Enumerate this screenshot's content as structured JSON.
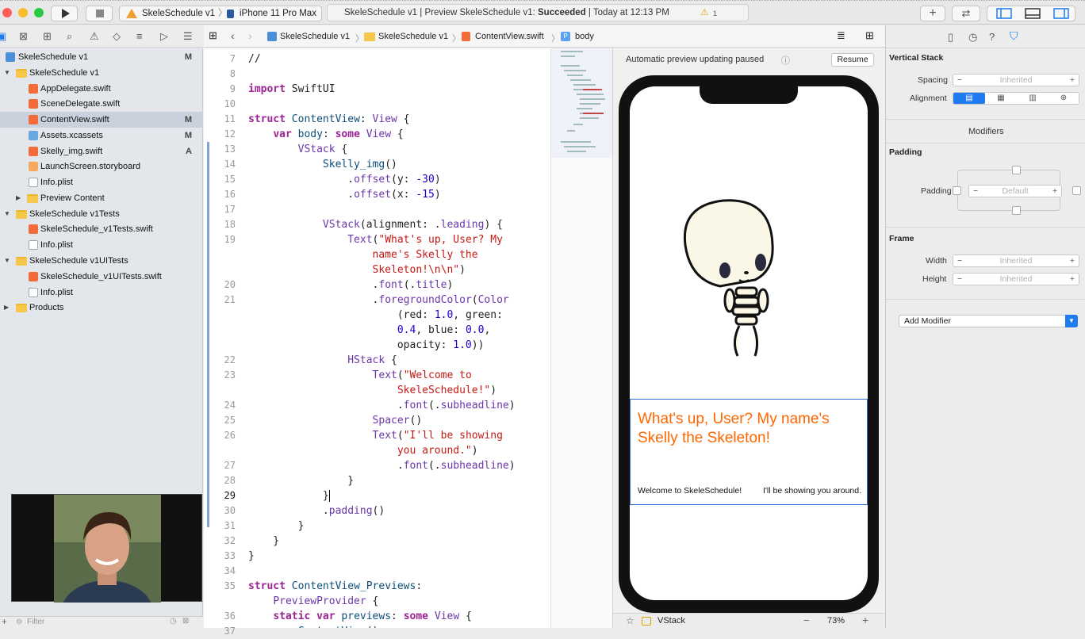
{
  "toolbar": {
    "scheme": "SkeleSchedule v1",
    "device": "iPhone 11 Pro Max",
    "status_prefix": "SkeleSchedule v1 | Preview SkeleSchedule v1: ",
    "status_bold": "Succeeded",
    "status_suffix": " | Today at 12:13 PM",
    "warning_count": "1"
  },
  "navigator": {
    "items": [
      {
        "label": "SkeleSchedule v1",
        "badge": "M"
      },
      {
        "label": "SkeleSchedule v1",
        "badge": ""
      },
      {
        "label": "AppDelegate.swift",
        "badge": ""
      },
      {
        "label": "SceneDelegate.swift",
        "badge": ""
      },
      {
        "label": "ContentView.swift",
        "badge": "M"
      },
      {
        "label": "Assets.xcassets",
        "badge": "M"
      },
      {
        "label": "Skelly_img.swift",
        "badge": "A"
      },
      {
        "label": "LaunchScreen.storyboard",
        "badge": ""
      },
      {
        "label": "Info.plist",
        "badge": ""
      },
      {
        "label": "Preview Content",
        "badge": ""
      },
      {
        "label": "SkeleSchedule v1Tests",
        "badge": ""
      },
      {
        "label": "SkeleSchedule_v1Tests.swift",
        "badge": ""
      },
      {
        "label": "Info.plist",
        "badge": ""
      },
      {
        "label": "SkeleSchedule v1UITests",
        "badge": ""
      },
      {
        "label": "SkeleSchedule_v1UITests.swift",
        "badge": ""
      },
      {
        "label": "Info.plist",
        "badge": ""
      },
      {
        "label": "Products",
        "badge": ""
      }
    ],
    "filter_placeholder": "Filter"
  },
  "jumpbar": {
    "project": "SkeleSchedule v1",
    "group": "SkeleSchedule v1",
    "file": "ContentView.swift",
    "symbol": "body"
  },
  "editor": {
    "line_numbers": [
      "7",
      "8",
      "9",
      "10",
      "11",
      "12",
      "13",
      "14",
      "15",
      "16",
      "17",
      "18",
      "19",
      "",
      "",
      "20",
      "21",
      "",
      "",
      "",
      "22",
      "23",
      "",
      "24",
      "25",
      "26",
      "",
      "27",
      "28",
      "29",
      "30",
      "31",
      "32",
      "33",
      "34",
      "35",
      "",
      "36",
      "37"
    ],
    "current_line": "29"
  },
  "preview": {
    "banner": "Automatic preview updating paused",
    "resume_label": "Resume",
    "heading": "What's up, User? My name's Skelly the Skeleton!",
    "welcome": "Welcome to SkeleSchedule!",
    "showing": "I'll be showing you around.",
    "bottom_stack": "VStack",
    "zoom": "73%"
  },
  "inspector": {
    "section_title": "Vertical Stack",
    "spacing_label": "Spacing",
    "spacing_value": "Inherited",
    "alignment_label": "Alignment",
    "modifiers_title": "Modifiers",
    "padding_title": "Padding",
    "padding_label": "Padding",
    "padding_value": "Default",
    "frame_title": "Frame",
    "width_label": "Width",
    "width_value": "Inherited",
    "height_label": "Height",
    "height_value": "Inherited",
    "add_modifier": "Add Modifier"
  },
  "colors": {
    "accent": "#1f7bef",
    "preview_text": "#ff6600",
    "selection": "#c9d1dc"
  }
}
